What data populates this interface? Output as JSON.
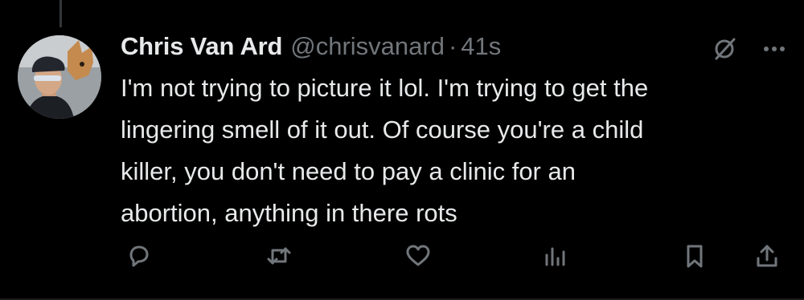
{
  "tweet": {
    "author": {
      "display_name": "Chris Van Ard",
      "handle": "@chrisvanard"
    },
    "separator": "·",
    "timestamp": "41s",
    "text": "I'm not trying to picture it lol. I'm trying to get the\nlingering smell of it out. Of course you're a child\nkiller, you don't need to pay a clinic for an\nabortion, anything in there rots"
  },
  "icons": {
    "top_right": [
      "grok-icon",
      "more-icon"
    ],
    "actions": [
      "reply-icon",
      "retweet-icon",
      "like-icon",
      "views-icon",
      "bookmark-icon",
      "share-icon"
    ]
  },
  "colors": {
    "background": "#000000",
    "text_primary": "#e7e9ea",
    "text_secondary": "#71767b"
  }
}
